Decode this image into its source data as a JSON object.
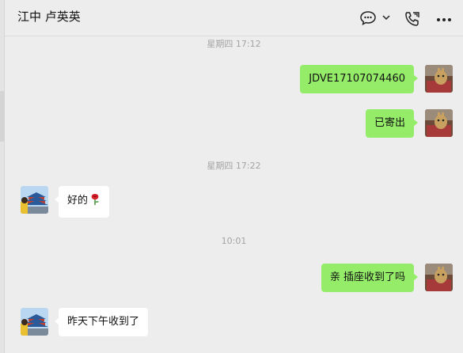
{
  "header": {
    "contact_name": "江中 卢英英"
  },
  "icons": {
    "chat": "chat-bubble-icon",
    "dropdown": "chevron-down-icon",
    "call": "phone-call-icon",
    "more": "more-dots-icon"
  },
  "colors": {
    "outgoing_bubble": "#95ec69",
    "incoming_bubble": "#ffffff",
    "background": "#ededed",
    "timestamp": "#a3a3a3"
  },
  "messages": {
    "ts1": "星期四 17:12",
    "m1": "JDVE17107074460",
    "m2": "已寄出",
    "ts2": "星期四 17:22",
    "m3": "好的",
    "m3_emoji": "rose-emoji",
    "ts3": "10:01",
    "m4": "亲 插座收到了吗",
    "m5": "昨天下午收到了"
  }
}
